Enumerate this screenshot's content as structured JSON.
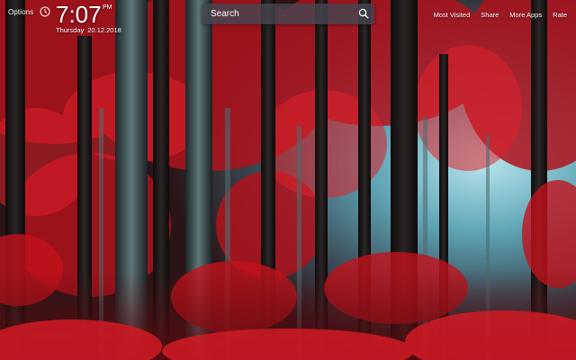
{
  "header": {
    "options_label": "Options",
    "time": "7:07",
    "ampm": "PM",
    "day": "Thursday",
    "date": "20.12.2018"
  },
  "search": {
    "placeholder": "Search"
  },
  "nav": {
    "items": [
      "Most Visited",
      "Share",
      "More Apps",
      "Rate"
    ]
  },
  "icons": [
    "clock-icon",
    "search-icon"
  ],
  "colors": {
    "accent_red": "#c4141c",
    "search_bg": "#464650",
    "mist": "#7fb6c4"
  }
}
